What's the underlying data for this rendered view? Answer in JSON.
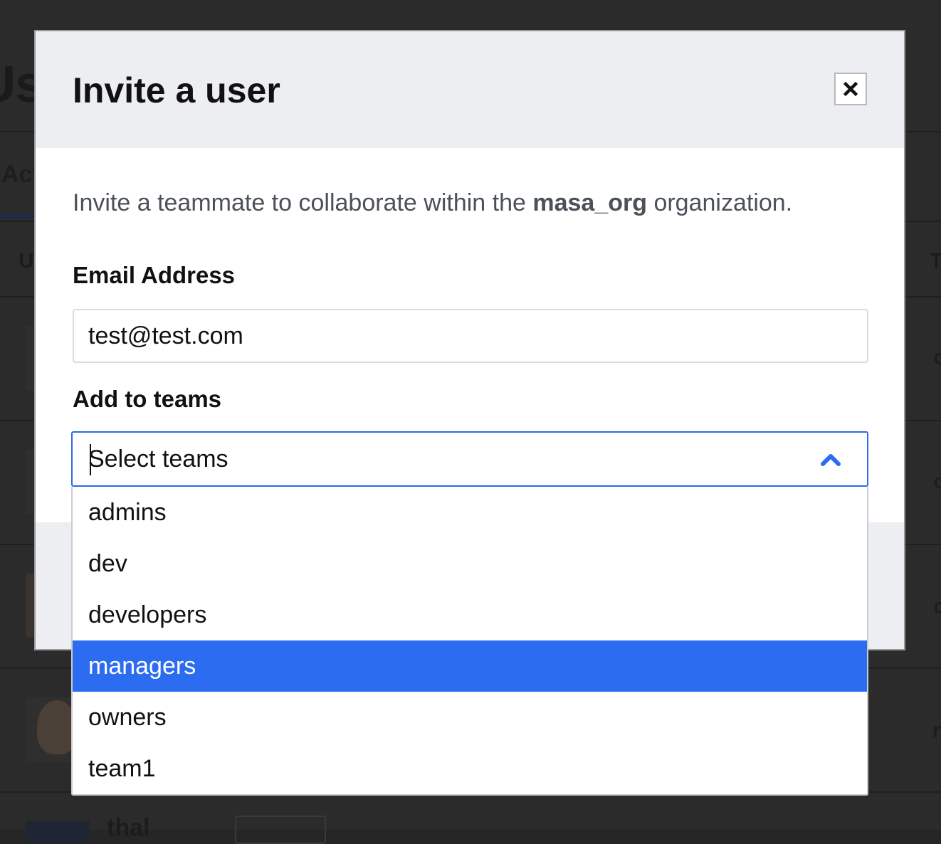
{
  "modal": {
    "title": "Invite a user",
    "intro_prefix": "Invite a teammate to collaborate within the ",
    "org_name": "masa_org",
    "intro_suffix": " organization.",
    "email_label": "Email Address",
    "email_value": "test@test.com",
    "teams_label": "Add to teams",
    "teams_placeholder": "Select teams",
    "close_icon": "close-icon"
  },
  "teams_dropdown": {
    "expanded": true,
    "highlighted": "managers",
    "options": [
      "admins",
      "dev",
      "developers",
      "managers",
      "owners",
      "team1"
    ]
  },
  "colors": {
    "accent": "#2c6cf0",
    "focus_border": "#2d6ae3",
    "header_bg": "#edeef1",
    "overlay": "#262626"
  }
}
